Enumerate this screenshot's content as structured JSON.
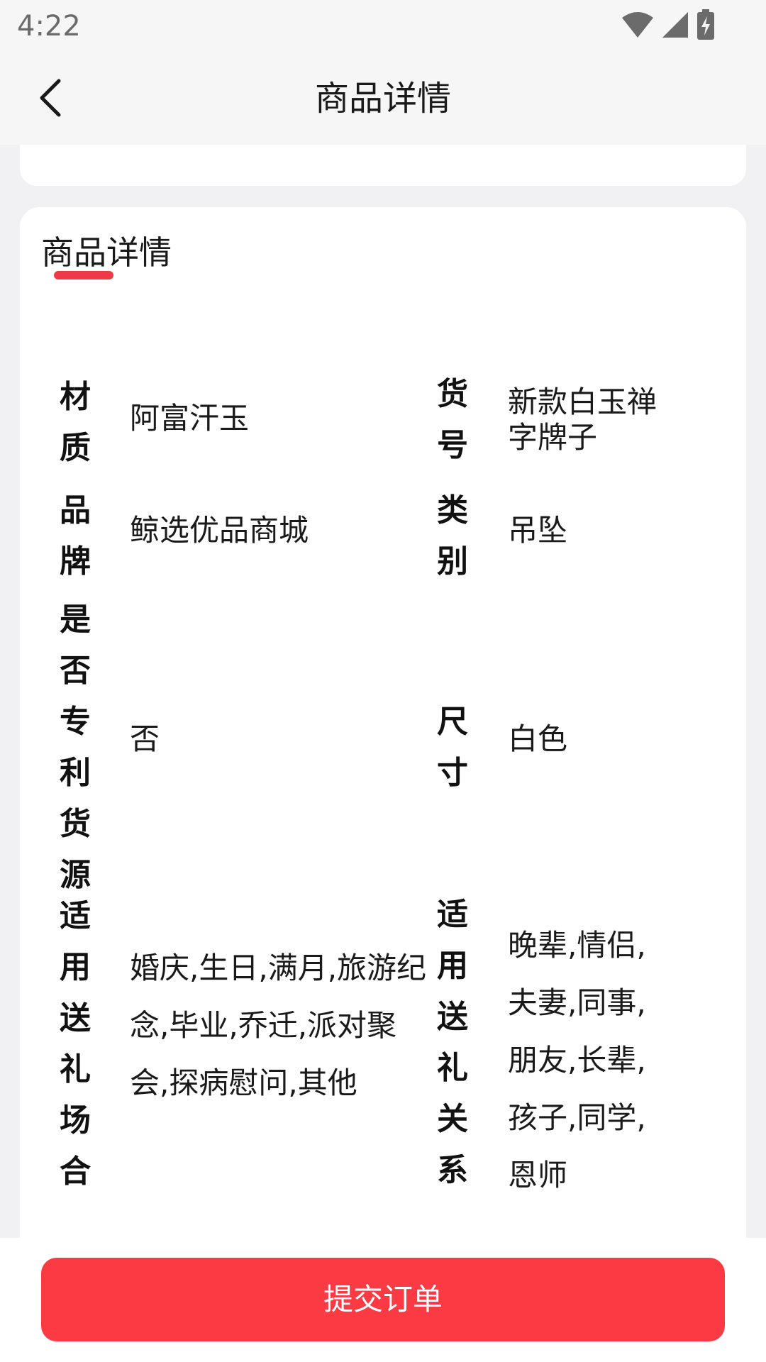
{
  "status_bar": {
    "time": "4:22",
    "icons": [
      "wifi-icon",
      "cellular-signal-icon",
      "battery-charging-icon"
    ]
  },
  "header": {
    "back_icon": "chevron-left-icon",
    "title": "商品详情"
  },
  "details": {
    "section_title": "商品详情",
    "accent_color": "#ee3a46",
    "rows": [
      {
        "left_label": "材质",
        "left_value": "阿富汗玉",
        "right_label": "货号",
        "right_value": "新款白玉禅字牌子"
      },
      {
        "left_label": "品牌",
        "left_value": "鲸选优品商城",
        "right_label": "类别",
        "right_value": "吊坠"
      },
      {
        "left_label": "是否专利货源",
        "left_value": "否",
        "right_label": "尺寸",
        "right_value": "白色"
      },
      {
        "left_label": "适用送礼场合",
        "left_value": "婚庆,生日,满月,旅游纪念,毕业,乔迁,派对聚会,探病慰问,其他",
        "right_label": "适用送礼关系",
        "right_value": "晚辈,情侣,夫妻,同事,朋友,长辈,孩子,同学,恩师"
      }
    ]
  },
  "footer": {
    "submit_label": "提交订单",
    "button_color": "#fb3a44"
  }
}
